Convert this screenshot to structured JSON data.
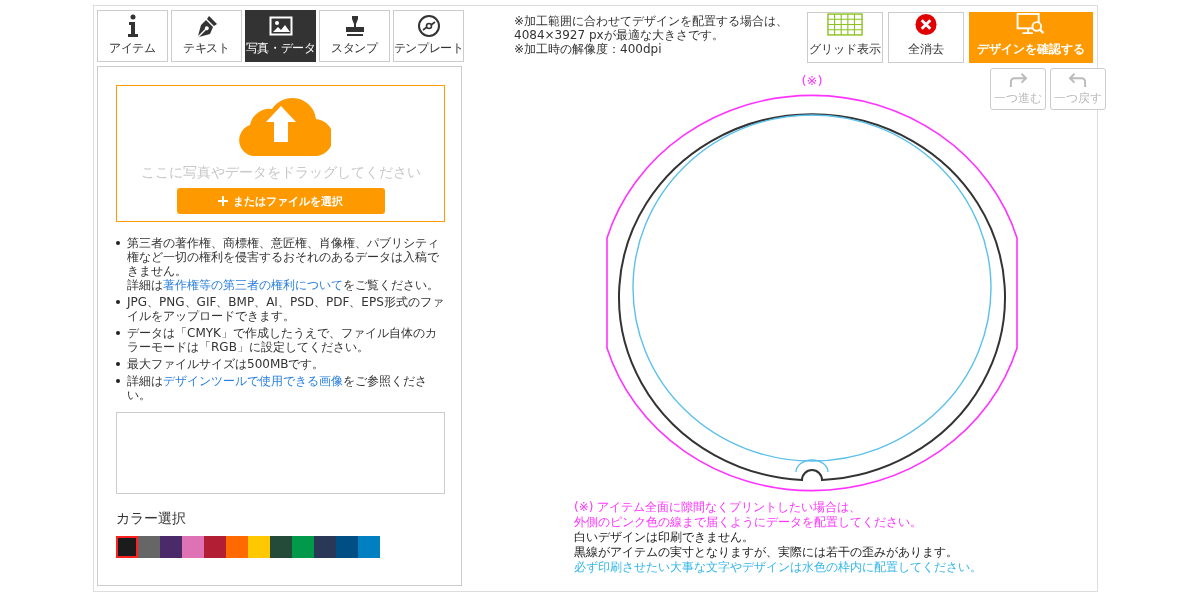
{
  "tabs": [
    {
      "label": "アイテム",
      "selected": false
    },
    {
      "label": "テキスト",
      "selected": false
    },
    {
      "label": "写真・データ",
      "selected": true
    },
    {
      "label": "スタンプ",
      "selected": false
    },
    {
      "label": "テンプレート",
      "selected": false
    }
  ],
  "upload": {
    "drop_hint": "ここに写真やデータをドラッグしてください",
    "button": "またはファイルを選択"
  },
  "notes": [
    {
      "segments": [
        {
          "kind": "text",
          "text": "第三者の著作権、商標権、意匠権、肖像権、パブリシティ権など一切の権利を侵害するおそれのあるデータは入稿できません。"
        },
        {
          "kind": "newline"
        },
        {
          "kind": "text",
          "text": "詳細は"
        },
        {
          "kind": "link",
          "text": "著作権等の第三者の権利について"
        },
        {
          "kind": "text",
          "text": "をご覧ください。"
        }
      ]
    },
    {
      "segments": [
        {
          "kind": "text",
          "text": "JPG、PNG、GIF、BMP、AI、PSD、PDF、EPS形式のファイルをアップロードできます。"
        }
      ]
    },
    {
      "segments": [
        {
          "kind": "text",
          "text": "データは「CMYK」で作成したうえで、ファイル自体のカラーモードは「RGB」に設定してください。"
        }
      ]
    },
    {
      "segments": [
        {
          "kind": "text",
          "text": "最大ファイルサイズは500MBです。"
        }
      ]
    },
    {
      "segments": [
        {
          "kind": "text",
          "text": "詳細は"
        },
        {
          "kind": "link",
          "text": "デザインツールで使用できる画像"
        },
        {
          "kind": "text",
          "text": "をご参照ください。"
        }
      ]
    }
  ],
  "color_select": {
    "title": "カラー選択",
    "swatches": [
      {
        "color": "#1a1b1d",
        "selected": true
      },
      {
        "color": "#666666",
        "selected": false
      },
      {
        "color": "#4a2a68",
        "selected": false
      },
      {
        "color": "#df72b4",
        "selected": false
      },
      {
        "color": "#b21e34",
        "selected": false
      },
      {
        "color": "#ff6a00",
        "selected": false
      },
      {
        "color": "#ffc800",
        "selected": false
      },
      {
        "color": "#244a3a",
        "selected": false
      },
      {
        "color": "#009a4a",
        "selected": false
      },
      {
        "color": "#2a3858",
        "selected": false
      },
      {
        "color": "#004f84",
        "selected": false
      },
      {
        "color": "#0080c0",
        "selected": false
      }
    ]
  },
  "info": [
    "※加工範囲に合わせてデザインを配置する場合は、",
    "4084×3927 pxが最適な大きさです。",
    "※加工時の解像度：400dpi"
  ],
  "toolbar": [
    {
      "label": "グリッド表示",
      "primary": false
    },
    {
      "label": "全消去",
      "primary": false
    },
    {
      "label": "デザインを確認する",
      "primary": true
    }
  ],
  "history": [
    {
      "label": "一つ進む",
      "disabled": true
    },
    {
      "label": "一つ戻す",
      "disabled": true
    }
  ],
  "canvas_mark": "(※)",
  "canvas_notes": [
    {
      "text": "(※) アイテム全面に隙間なくプリントしたい場合は、",
      "kind": "pink"
    },
    {
      "text": "外側のピンク色の線まで届くようにデータを配置してください。",
      "kind": "pink"
    },
    {
      "text": "白いデザインは印刷できません。",
      "kind": "black"
    },
    {
      "text": "黒線がアイテムの実寸となりますが、実際には若干の歪みがあります。",
      "kind": "black"
    },
    {
      "text": "必ず印刷させたい大事な文字やデザインは水色の枠内に配置してください。",
      "kind": "blue"
    }
  ]
}
